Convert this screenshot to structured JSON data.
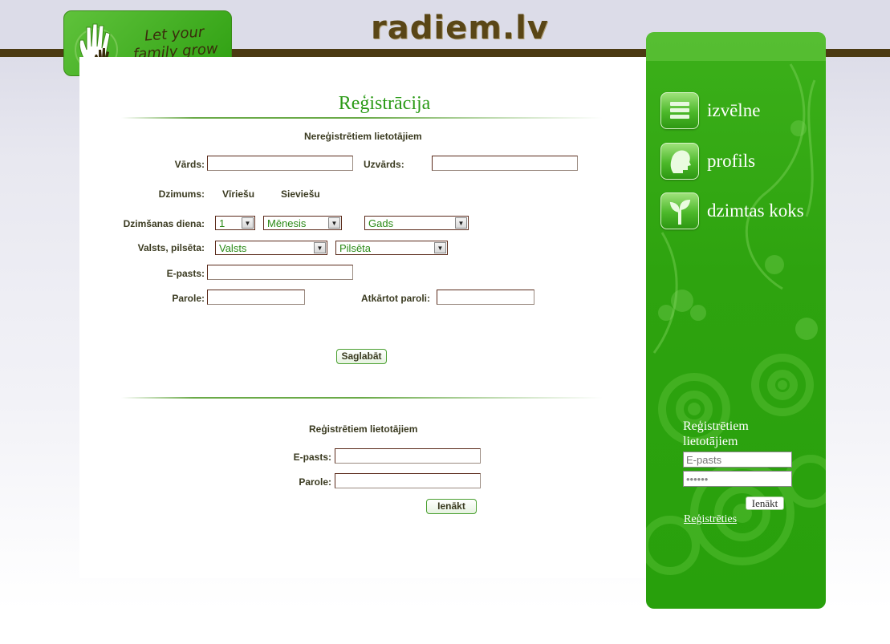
{
  "header": {
    "site_title": "radiem.lv",
    "logo_text": "Let your family grow"
  },
  "registration": {
    "title": "Reģistrācija",
    "unregistered_heading": "Nereģistrētiem lietotājiem",
    "first_name_label": "Vārds:",
    "first_name_value": "",
    "last_name_label": "Uzvārds:",
    "last_name_value": "",
    "gender_label": "Dzimums:",
    "gender_male": "Vīriešu",
    "gender_female": "Sieviešu",
    "birthday_label": "Dzimšanas diena:",
    "day_value": "1",
    "month_value": "Mēnesis",
    "year_value": "Gads",
    "location_label": "Valsts, pilsēta:",
    "country_value": "Valsts",
    "city_value": "Pilsēta",
    "email_label": "E-pasts:",
    "password_label": "Parole:",
    "repeat_password_label": "Atkārtot paroli:",
    "save_button": "Saglabāt"
  },
  "login": {
    "registered_heading": "Reģistrētiem lietotājiem",
    "email_label": "E-pasts:",
    "password_label": "Parole:",
    "login_button": "Ienākt"
  },
  "sidebar": {
    "nav": [
      {
        "label": "izvēlne",
        "icon": "menu-icon"
      },
      {
        "label": "profils",
        "icon": "profile-icon"
      },
      {
        "label": "dzimtas koks",
        "icon": "tree-icon"
      }
    ],
    "login_title": "Reģistrētiem lietotājiem",
    "email_placeholder": "E-pasts",
    "password_value": "••••••",
    "login_button": "Ienākt",
    "register_link": "Reģistrēties"
  },
  "colors": {
    "accent_green": "#2a9a16",
    "header_brown": "#4b3a12",
    "sidebar_green": "#2ea30f"
  }
}
